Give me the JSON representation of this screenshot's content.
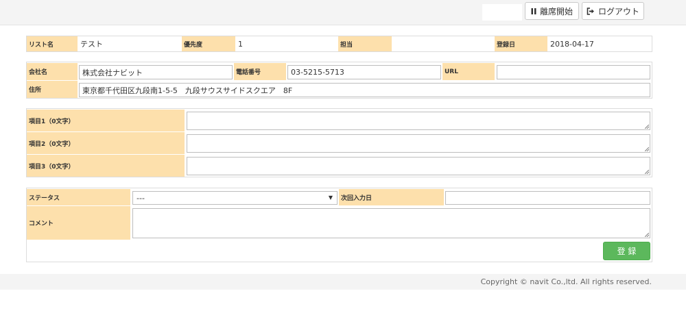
{
  "header": {
    "break_button": "離席開始",
    "logout_button": "ログアウト"
  },
  "list_info": {
    "list_name_label": "リスト名",
    "list_name_value": "テスト",
    "priority_label": "優先度",
    "priority_value": "1",
    "owner_label": "担当",
    "owner_value": "",
    "registered_label": "登録日",
    "registered_value": "2018-04-17"
  },
  "company": {
    "name_label": "会社名",
    "name_value": "株式会社ナビット",
    "phone_label": "電話番号",
    "phone_value": "03-5215-5713",
    "url_label": "URL",
    "url_value": "",
    "address_label": "住所",
    "address_value": "東京都千代田区九段南1-5-5　九段サウスサイドスクエア　8F"
  },
  "items": [
    {
      "label": "項目1（0文字）",
      "value": ""
    },
    {
      "label": "項目2（0文字）",
      "value": ""
    },
    {
      "label": "項目3（0文字）",
      "value": ""
    }
  ],
  "status_form": {
    "status_label": "ステータス",
    "status_selected": "---",
    "next_date_label": "次回入力日",
    "next_date_value": "",
    "comment_label": "コメント",
    "comment_value": "",
    "submit_label": "登 録"
  },
  "footer": {
    "copyright": "Copyright © navit Co.,ltd. All rights reserved."
  }
}
